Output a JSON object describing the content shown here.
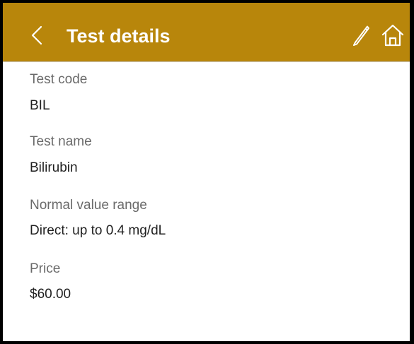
{
  "header": {
    "title": "Test details",
    "back_icon": "chevron-left-icon",
    "edit_icon": "pencil-icon",
    "home_icon": "home-icon",
    "background_color": "#b8860b"
  },
  "fields": [
    {
      "label": "Test code",
      "value": "BIL"
    },
    {
      "label": "Test name",
      "value": "Bilirubin"
    },
    {
      "label": "Normal value range",
      "value": "Direct: up to 0.4 mg/dL"
    },
    {
      "label": "Price",
      "value": "$60.00"
    }
  ]
}
